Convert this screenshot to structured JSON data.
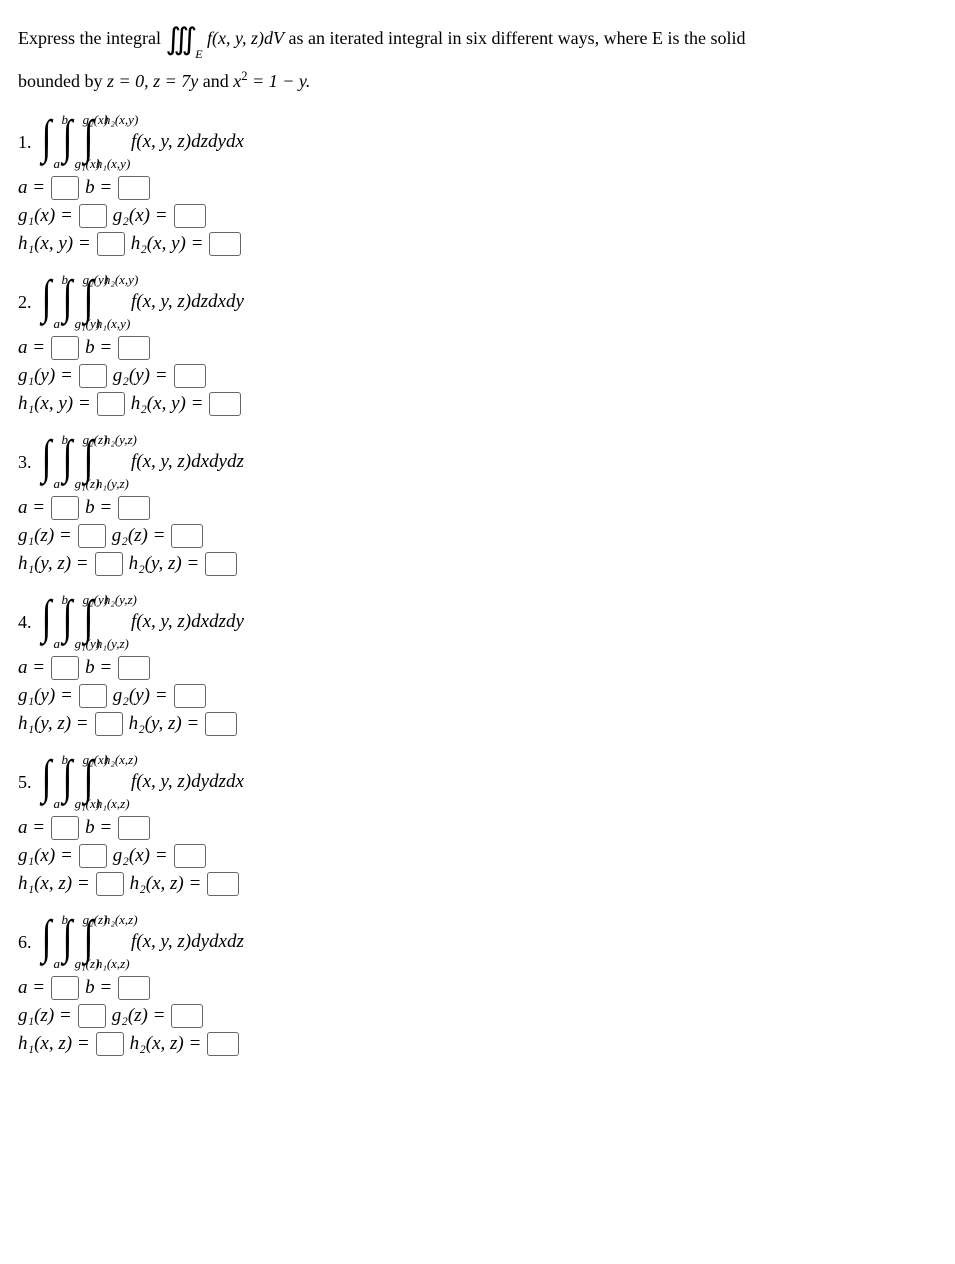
{
  "prompt": {
    "l1a": "Express the integral ",
    "l1_int": "∭",
    "l1_sub": "E",
    "l1_fn": " f(x, y, z)dV",
    "l1b": " as an iterated integral in six different ways, where E is the solid",
    "l2a": "bounded by ",
    "l2_eq": "z = 0, z = 7y",
    "l2b": " and ",
    "l2_eq2": "x² = 1 − y.",
    "note": ""
  },
  "items": [
    {
      "n": "1.",
      "u1": "b",
      "l1": "a",
      "u2": "g₂(x)",
      "l2": "g₁(x)",
      "u3": "h₂(x,y)",
      "l3": "h₁(x,y)",
      "integrand": "f(x, y, z)dzdydx",
      "rows": [
        {
          "cells": [
            "a =",
            "",
            "b =",
            ""
          ]
        },
        {
          "cells": [
            "g₁(x) =",
            "",
            "g₂(x) =",
            ""
          ]
        },
        {
          "cells": [
            "h₁(x, y) =",
            "",
            "h₂(x, y) =",
            ""
          ]
        }
      ]
    },
    {
      "n": "2.",
      "u1": "b",
      "l1": "a",
      "u2": "g₂(y)",
      "l2": "g₁(y)",
      "u3": "h₂(x,y)",
      "l3": "h₁(x,y)",
      "integrand": "f(x, y, z)dzdxdy",
      "rows": [
        {
          "cells": [
            "a =",
            "",
            "b =",
            ""
          ]
        },
        {
          "cells": [
            "g₁(y) =",
            "",
            "g₂(y) =",
            ""
          ]
        },
        {
          "cells": [
            "h₁(x, y) =",
            "",
            "h₂(x, y) =",
            ""
          ]
        }
      ]
    },
    {
      "n": "3.",
      "u1": "b",
      "l1": "a",
      "u2": "g₂(z)",
      "l2": "g₁(z)",
      "u3": "h₂(y,z)",
      "l3": "h₁(y,z)",
      "integrand": "f(x, y, z)dxdydz",
      "rows": [
        {
          "cells": [
            "a =",
            "",
            "b =",
            ""
          ]
        },
        {
          "cells": [
            "g₁(z) =",
            "",
            "g₂(z) =",
            ""
          ]
        },
        {
          "cells": [
            "h₁(y, z) =",
            "",
            "h₂(y, z) =",
            ""
          ]
        }
      ]
    },
    {
      "n": "4.",
      "u1": "b",
      "l1": "a",
      "u2": "g₂(y)",
      "l2": "g₁(y)",
      "u3": "h₂(y,z)",
      "l3": "h₁(y,z)",
      "integrand": "f(x, y, z)dxdzdy",
      "rows": [
        {
          "cells": [
            "a =",
            "",
            "b =",
            ""
          ]
        },
        {
          "cells": [
            "g₁(y) =",
            "",
            "g₂(y) =",
            ""
          ]
        },
        {
          "cells": [
            "h₁(y, z) =",
            "",
            "h₂(y, z) =",
            ""
          ]
        }
      ]
    },
    {
      "n": "5.",
      "u1": "b",
      "l1": "a",
      "u2": "g₂(x)",
      "l2": "g₁(x)",
      "u3": "h₂(x,z)",
      "l3": "h₁(x,z)",
      "integrand": "f(x, y, z)dydzdx",
      "rows": [
        {
          "cells": [
            "a =",
            "",
            "b =",
            ""
          ]
        },
        {
          "cells": [
            "g₁(x) =",
            "",
            "g₂(x) =",
            ""
          ]
        },
        {
          "cells": [
            "h₁(x, z) =",
            "",
            "h₂(x, z) =",
            ""
          ]
        }
      ]
    },
    {
      "n": "6.",
      "u1": "b",
      "l1": "a",
      "u2": "g₂(z)",
      "l2": "g₁(z)",
      "u3": "h₂(x,z)",
      "l3": "h₁(x,z)",
      "integrand": "f(x, y, z)dydxdz",
      "rows": [
        {
          "cells": [
            "a =",
            "",
            "b =",
            ""
          ]
        },
        {
          "cells": [
            "g₁(z) =",
            "",
            "g₂(z) =",
            ""
          ]
        },
        {
          "cells": [
            "h₁(x, z) =",
            "",
            "h₂(x, z) =",
            ""
          ]
        }
      ]
    }
  ]
}
